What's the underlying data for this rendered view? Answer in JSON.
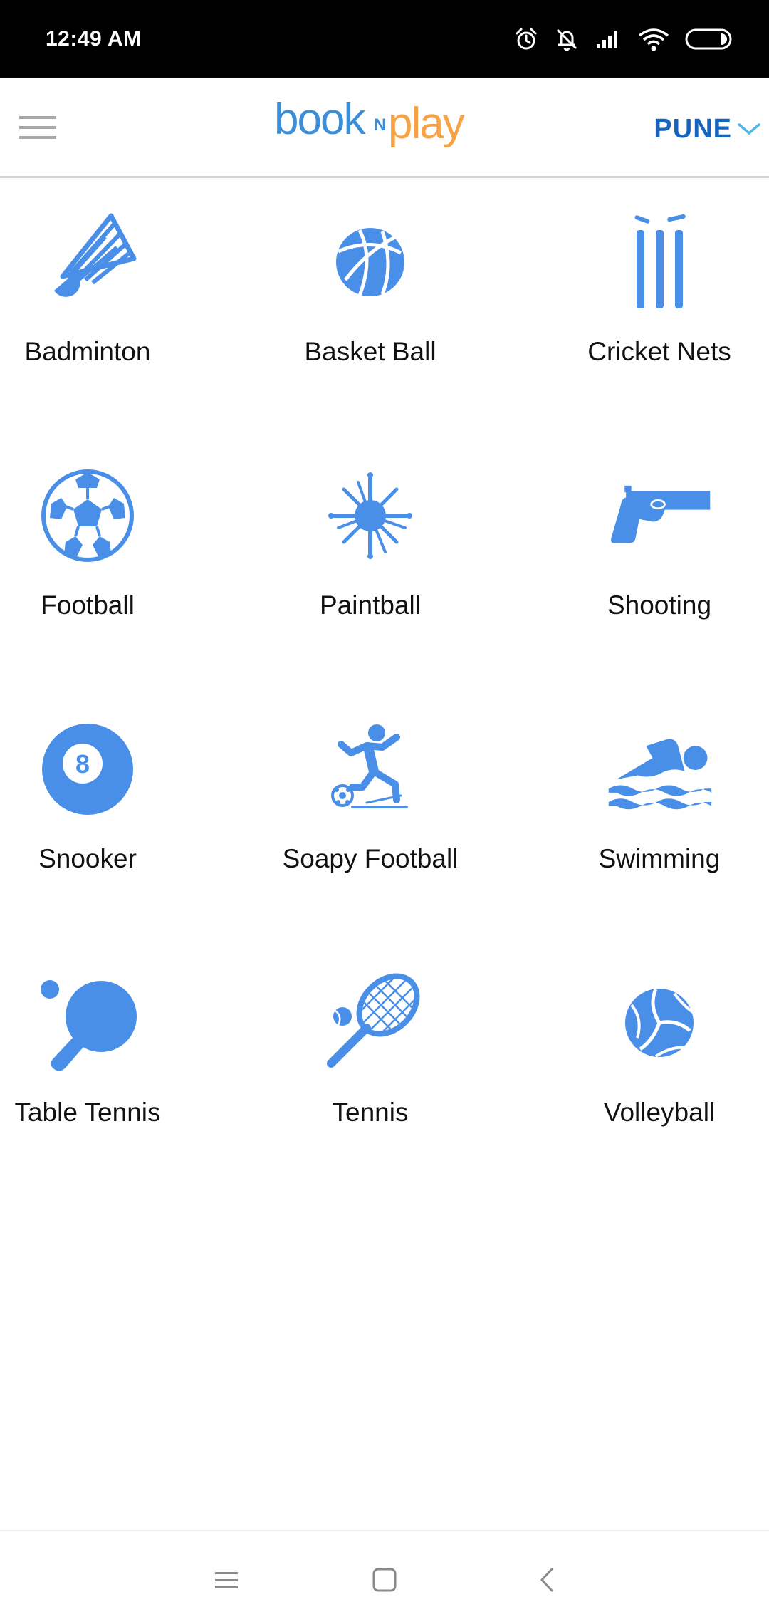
{
  "status_bar": {
    "time": "12:49 AM",
    "icons": [
      "alarm-icon",
      "notifications-off-icon",
      "signal-icon",
      "wifi-icon",
      "battery-icon"
    ]
  },
  "app_bar": {
    "menu_icon": "hamburger-menu-icon",
    "logo": {
      "part_book": "book",
      "part_n": "N",
      "part_play": "play"
    },
    "city": "PUNE",
    "city_icon": "chevron-down-icon"
  },
  "colors": {
    "accent_blue": "#4a8fe7",
    "logo_blue": "#3b8ed8",
    "logo_orange": "#f7a345",
    "city_blue": "#1565c0"
  },
  "sports": [
    {
      "label": "Badminton",
      "icon": "shuttlecock-icon"
    },
    {
      "label": "Basket Ball",
      "icon": "basketball-icon"
    },
    {
      "label": "Cricket Nets",
      "icon": "cricket-stumps-icon"
    },
    {
      "label": "Football",
      "icon": "football-icon"
    },
    {
      "label": "Paintball",
      "icon": "paint-splat-icon"
    },
    {
      "label": "Shooting",
      "icon": "pistol-icon"
    },
    {
      "label": "Snooker",
      "icon": "eight-ball-icon",
      "badge": "8"
    },
    {
      "label": "Soapy Football",
      "icon": "soapy-football-player-icon"
    },
    {
      "label": "Swimming",
      "icon": "swimmer-icon"
    },
    {
      "label": "Table Tennis",
      "icon": "ping-pong-paddle-icon"
    },
    {
      "label": "Tennis",
      "icon": "tennis-racket-icon"
    },
    {
      "label": "Volleyball",
      "icon": "volleyball-icon"
    }
  ],
  "nav_bar": {
    "buttons": [
      "recents-icon",
      "home-icon",
      "back-icon"
    ]
  }
}
